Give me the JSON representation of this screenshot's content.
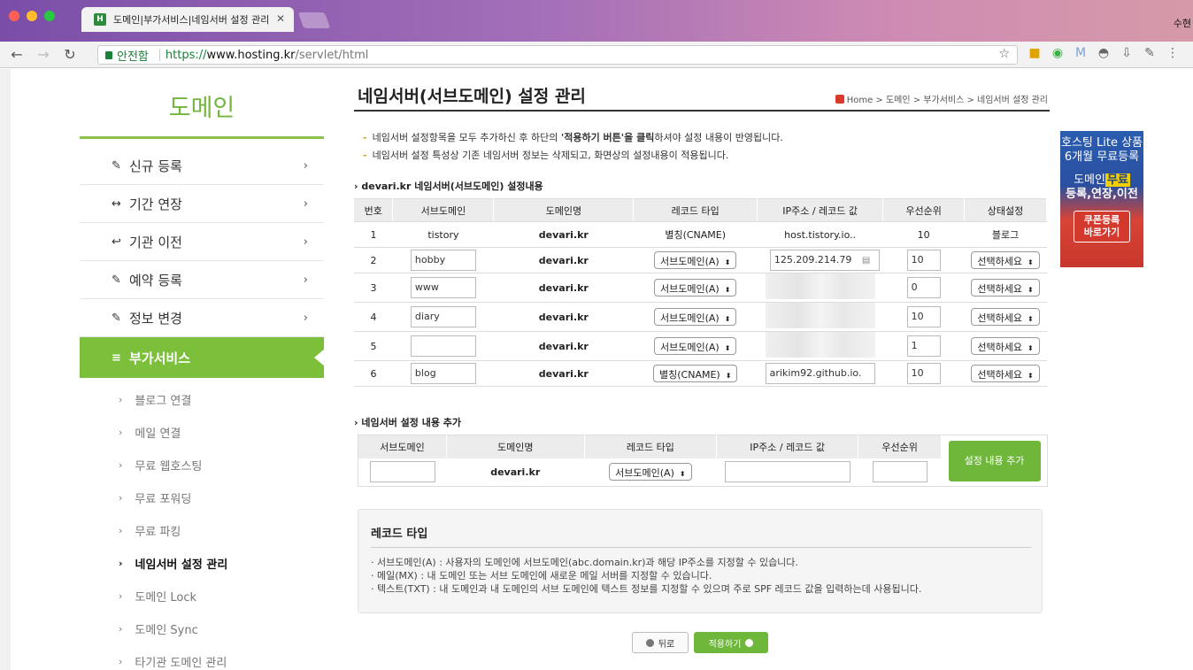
{
  "browser": {
    "tab_title": "도메인|부가서비스|네임서버 설정 관리",
    "tab_favicon": "H",
    "top_right_text": "수현",
    "security_label": "안전함",
    "url_proto": "https://",
    "url_host": "www.hosting.kr",
    "url_path": "/servlet/html",
    "extensions": [
      "hosting-ext-icon",
      "refresh-ext-icon",
      "gmail-ext-icon",
      "mask-ext-icon",
      "download-ext-icon",
      "dropper-ext-icon"
    ]
  },
  "sidebar": {
    "title": "도메인",
    "items": [
      {
        "icon": "✎",
        "label": "신규 등록"
      },
      {
        "icon": "↔",
        "label": "기간 연장"
      },
      {
        "icon": "↩",
        "label": "기관 이전"
      },
      {
        "icon": "✎",
        "label": "예약 등록"
      },
      {
        "icon": "✎",
        "label": "정보 변경"
      }
    ],
    "active": {
      "icon": "≡",
      "label": "부가서비스"
    },
    "subitems": [
      "블로그 연결",
      "메일 연결",
      "무료 웹호스팅",
      "무료 포워딩",
      "무료 파킹",
      "네임서버 설정 관리",
      "도메인 Lock",
      "도메인 Sync",
      "타기관 도메인 관리"
    ],
    "current_sub": "네임서버 설정 관리"
  },
  "main": {
    "title": "네임서버(서브도메인) 설정 관리",
    "breadcrumb": "Home > 도메인 > 부가서비스 > 네임서버 설정 관리",
    "note1_pre": "네임서버 설정항목을 모두 추가하신 후 하단의 ",
    "note1_bold": "'적용하기 버튼'을 클릭",
    "note1_post": "하셔야 설정 내용이 반영됩니다.",
    "note2": "네임서버 설정 특성상 기존 네임서버 정보는 삭제되고, 화면상의 설정내용이 적용됩니다.",
    "section1": "› devari.kr 네임서버(서브도메인) 설정내용",
    "section2": "› 네임서버 설정 내용 추가"
  },
  "table1": {
    "headers": [
      "번호",
      "서브도메인",
      "도메인명",
      "레코드 타입",
      "IP주소 / 레코드 값",
      "우선순위",
      "상태설정"
    ],
    "rows": [
      {
        "no": "1",
        "sub": "tistory",
        "domain": "devari.kr",
        "type": "별칭(CNAME)",
        "ip": "host.tistory.io..",
        "priority": "10",
        "status": "블로그",
        "editable": false
      },
      {
        "no": "2",
        "sub": "hobby",
        "domain": "devari.kr",
        "type": "서브도메인(A)",
        "ip": "125.209.214.79",
        "priority": "10",
        "status": "선택하세요",
        "editable": true
      },
      {
        "no": "3",
        "sub": "www",
        "domain": "devari.kr",
        "type": "서브도메인(A)",
        "ip": "",
        "priority": "0",
        "status": "선택하세요",
        "editable": true,
        "blurred": true
      },
      {
        "no": "4",
        "sub": "diary",
        "domain": "devari.kr",
        "type": "서브도메인(A)",
        "ip": "",
        "priority": "10",
        "status": "선택하세요",
        "editable": true,
        "blurred": true
      },
      {
        "no": "5",
        "sub": "",
        "domain": "devari.kr",
        "type": "서브도메인(A)",
        "ip": "",
        "priority": "1",
        "status": "선택하세요",
        "editable": true,
        "blurred": true
      },
      {
        "no": "6",
        "sub": "blog",
        "domain": "devari.kr",
        "type": "별칭(CNAME)",
        "ip": "arikim92.github.io.",
        "priority": "10",
        "status": "선택하세요",
        "editable": true
      }
    ]
  },
  "table2": {
    "headers": [
      "서브도메인",
      "도메인명",
      "레코드 타입",
      "IP주소 / 레코드 값",
      "우선순위"
    ],
    "domain": "devari.kr",
    "type": "서브도메인(A)",
    "add_button": "설정 내용 추가"
  },
  "info": {
    "title": "레코드 타입",
    "lines": [
      "· 서브도메인(A) : 사용자의 도메인에 서브도메인(abc.domain.kr)과 해당 IP주소를 지정할 수 있습니다.",
      "· 메일(MX) : 내 도메인 또는 서브 도메인에 새로운 메일 서버를 지정할 수 있습니다.",
      "· 텍스트(TXT) : 내 도메인과 내 도메인의 서브 도메인에 텍스트 정보를 지정할 수 있으며 주로 SPF 레코드 값을 입력하는데 사용됩니다."
    ]
  },
  "buttons": {
    "back": "뒤로",
    "apply": "적용하기"
  },
  "ad": {
    "line1a": "호스팅 Lite 상품",
    "line1b": "6개월 무료등록",
    "line2a_pre": "도메인",
    "line2a_hl": "무료",
    "line2b": "등록,연장,이전",
    "coupon1": "쿠폰등록",
    "coupon2": "바로가기"
  },
  "colors": {
    "accent": "#7bbf3b",
    "title_green": "#73b53d",
    "note_dash": "#e0a400"
  }
}
